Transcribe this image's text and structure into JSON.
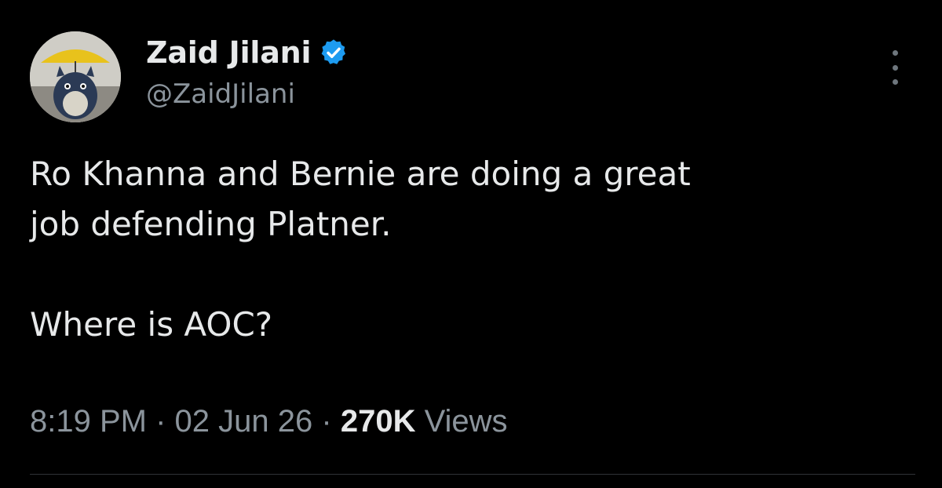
{
  "author": {
    "display_name": "Zaid Jilani",
    "handle": "@ZaidJilani",
    "verified": true,
    "avatar_icon": "avatar-umbrella-totoro"
  },
  "menu": {
    "icon": "more-vertical-icon"
  },
  "tweet": {
    "line1": "Ro Khanna and Bernie are doing a great",
    "line2": "job defending Platner.",
    "line3": "Where is AOC?"
  },
  "meta": {
    "time": "8:19 PM",
    "separator": "·",
    "date": "02 Jun 26",
    "views_count": "270K",
    "views_label": "Views"
  },
  "colors": {
    "background": "#000000",
    "primary_text": "#e7e9ea",
    "secondary_text": "#8b949c",
    "verified_badge": "#1d9bf0",
    "divider": "#2f3336"
  }
}
